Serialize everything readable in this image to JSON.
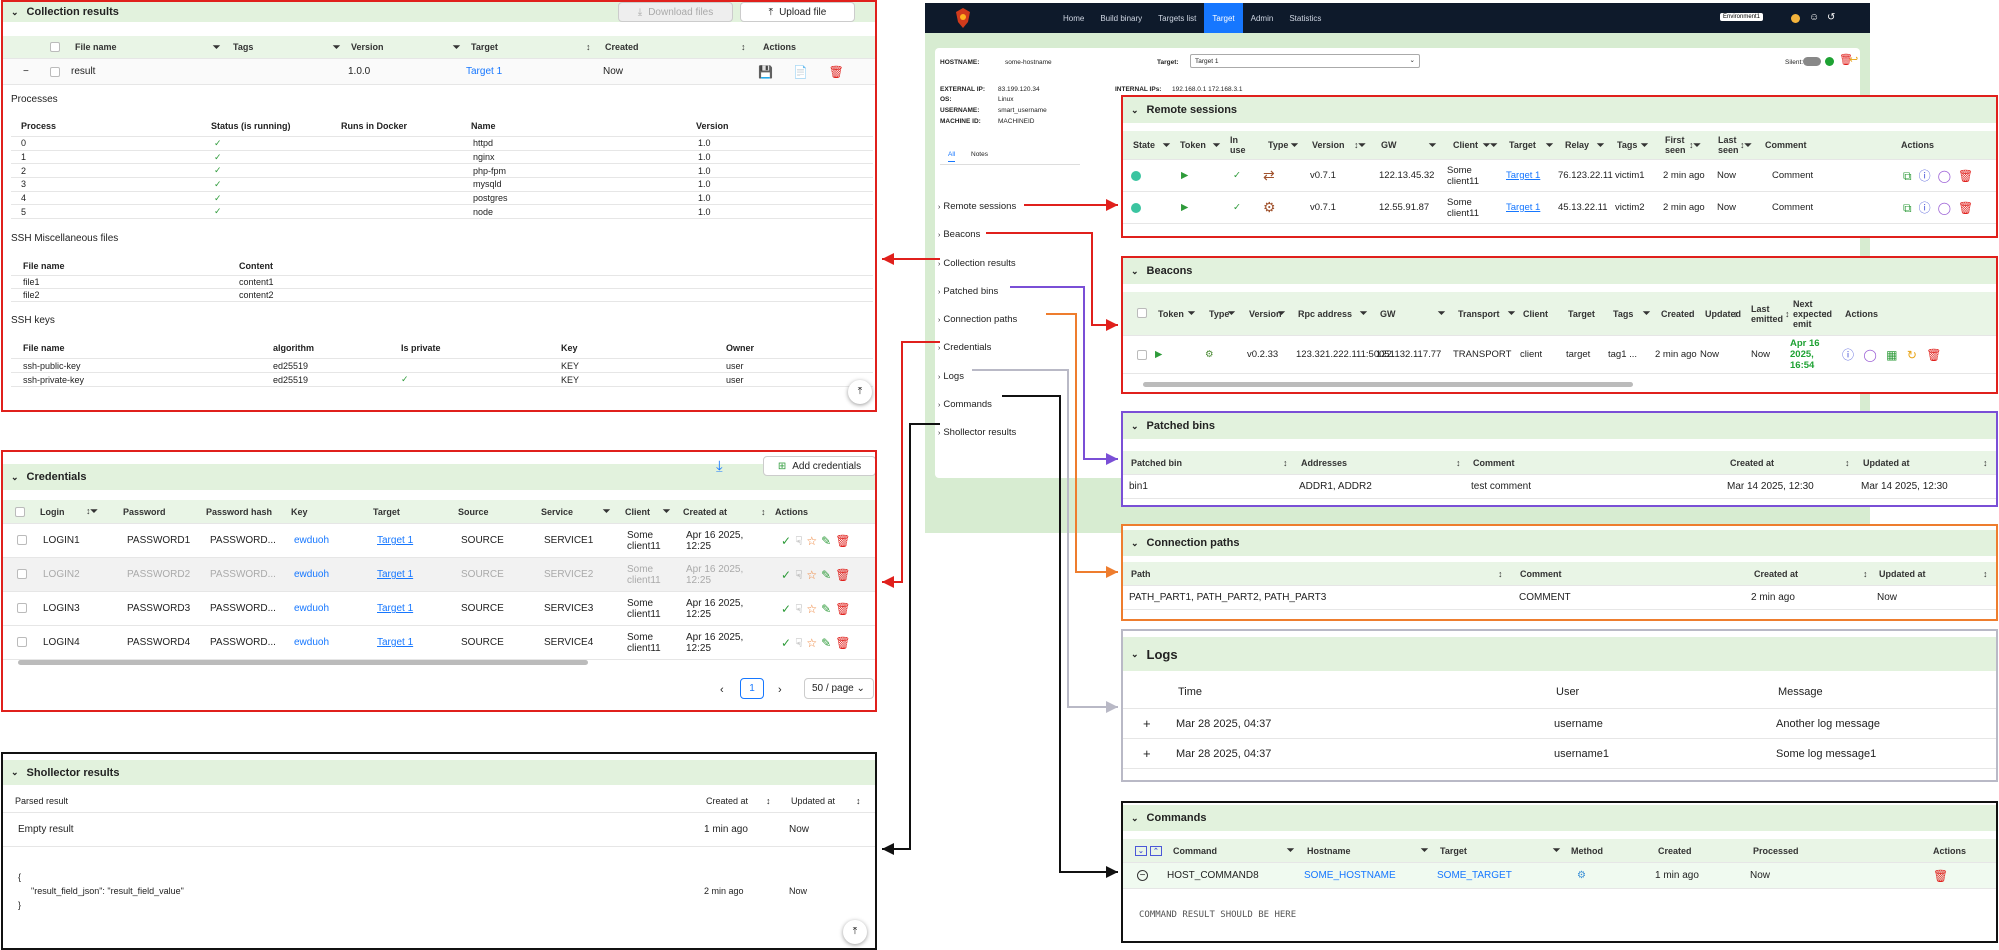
{
  "colors": {
    "red": "#e0201c",
    "black": "#111111",
    "purple": "#7a4fd6",
    "orange": "#ee7d2e",
    "gray": "#b9b9c6",
    "headerGreen": "#e2f2dd",
    "link": "#1677ff",
    "navBg": "#0e1a2b"
  },
  "app": {
    "nav": [
      "Home",
      "Build binary",
      "Targets list",
      "Target",
      "Admin",
      "Statistics"
    ],
    "env_label": "Environment1",
    "hostname_label": "HOSTNAME:",
    "hostname_value": "some-hostname",
    "target_label": "Target:",
    "target_value": "Target 1",
    "silent_label": "Silent:",
    "external_ip_label": "EXTERNAL IP:",
    "external_ip_value": "83.199.120.34",
    "internal_ips_label": "INTERNAL IPs:",
    "internal_ips_value": "192.168.0.1 172.168.3.1",
    "os_label": "OS:",
    "os_value": "Linux",
    "username_label": "USERNAME:",
    "username_value": "smart_username",
    "machine_id_label": "MACHINE ID:",
    "machine_id_value": "MACHINEID",
    "tabs": [
      "All",
      "Notes"
    ],
    "sections": [
      "Remote sessions",
      "Beacons",
      "Collection results",
      "Patched bins",
      "Connection paths",
      "Credentials",
      "Logs",
      "Commands",
      "Shollector results"
    ]
  },
  "collection": {
    "title": "Collection results",
    "download_label": "Download files",
    "upload_label": "Upload file",
    "headers": [
      "File name",
      "Tags",
      "Version",
      "Target",
      "Created",
      "Actions"
    ],
    "row": {
      "name": "result",
      "version": "1.0.0",
      "target": "Target 1",
      "created": "Now"
    },
    "processes_title": "Processes",
    "process_headers": [
      "Process",
      "Status (is running)",
      "Runs in Docker",
      "Name",
      "Version"
    ],
    "processes": [
      [
        "0",
        "httpd",
        "1.0"
      ],
      [
        "1",
        "nginx",
        "1.0"
      ],
      [
        "2",
        "php-fpm",
        "1.0"
      ],
      [
        "3",
        "mysqld",
        "1.0"
      ],
      [
        "4",
        "postgres",
        "1.0"
      ],
      [
        "5",
        "node",
        "1.0"
      ]
    ],
    "ssh_misc_title": "SSH Miscellaneous files",
    "ssh_misc_headers": [
      "File name",
      "Content"
    ],
    "ssh_misc": [
      [
        "file1",
        "content1"
      ],
      [
        "file2",
        "content2"
      ]
    ],
    "ssh_keys_title": "SSH keys",
    "ssh_keys_headers": [
      "File name",
      "algorithm",
      "Is private",
      "Key",
      "Owner"
    ],
    "ssh_keys": [
      [
        "ssh-public-key",
        "ed25519",
        "KEY",
        "user"
      ],
      [
        "ssh-private-key",
        "ed25519",
        "KEY",
        "user"
      ]
    ]
  },
  "credentials": {
    "title": "Credentials",
    "add_label": "Add credentials",
    "headers": [
      "Login",
      "Password",
      "Password hash",
      "Key",
      "Target",
      "Source",
      "Service",
      "Client",
      "Created at",
      "Actions"
    ],
    "rows": [
      [
        "LOGIN1",
        "PASSWORD1",
        "PASSWORD...",
        "ewduoh",
        "Target 1",
        "SOURCE",
        "SERVICE1",
        "Some client11",
        "Apr 16 2025, 12:25"
      ],
      [
        "LOGIN2",
        "PASSWORD2",
        "PASSWORD...",
        "ewduoh",
        "Target 1",
        "SOURCE",
        "SERVICE2",
        "Some client11",
        "Apr 16 2025, 12:25"
      ],
      [
        "LOGIN3",
        "PASSWORD3",
        "PASSWORD...",
        "ewduoh",
        "Target 1",
        "SOURCE",
        "SERVICE3",
        "Some client11",
        "Apr 16 2025, 12:25"
      ],
      [
        "LOGIN4",
        "PASSWORD4",
        "PASSWORD...",
        "ewduoh",
        "Target 1",
        "SOURCE",
        "SERVICE4",
        "Some client11",
        "Apr 16 2025, 12:25"
      ]
    ],
    "page": "1",
    "page_size": "50 / page"
  },
  "shollector": {
    "title": "Shollector results",
    "headers": [
      "Parsed result",
      "Created at",
      "Updated at"
    ],
    "rows": [
      [
        "Empty result",
        "1 min ago",
        "Now"
      ]
    ],
    "json_lines": [
      "{",
      "\"result_field_json\": \"result_field_value\"",
      "}"
    ],
    "json_created": "2 min ago",
    "json_updated": "Now"
  },
  "remote": {
    "title": "Remote sessions",
    "headers": [
      "State",
      "Token",
      "In use",
      "Type",
      "Version",
      "GW",
      "Client",
      "Target",
      "Relay",
      "Tags",
      "First seen",
      "Last seen",
      "Comment",
      "Actions"
    ],
    "rows": [
      [
        "v0.7.1",
        "122.13.45.32",
        "Some client11",
        "Target 1",
        "76.123.22.11",
        "victim1",
        "2 min ago",
        "Now",
        "Comment"
      ],
      [
        "v0.7.1",
        "12.55.91.87",
        "Some client11",
        "Target 1",
        "45.13.22.11",
        "victim2",
        "2 min ago",
        "Now",
        "Comment"
      ]
    ]
  },
  "beacons": {
    "title": "Beacons",
    "headers": [
      "Token",
      "Type",
      "Version",
      "Rpc address",
      "GW",
      "Transport",
      "Client",
      "Target",
      "Tags",
      "Created",
      "Updated",
      "Last emitted",
      "Next expected emit",
      "Actions"
    ],
    "row": [
      "v0.2.33",
      "123.321.222.111:50051",
      "122.132.117.77",
      "TRANSPORT",
      "client",
      "target",
      "tag1 ...",
      "2 min ago",
      "Now",
      "Now",
      "Apr 16 2025, 16:54"
    ]
  },
  "patched": {
    "title": "Patched bins",
    "headers": [
      "Patched bin",
      "Addresses",
      "Comment",
      "Created at",
      "Updated at"
    ],
    "row": [
      "bin1",
      "ADDR1, ADDR2",
      "test comment",
      "Mar 14 2025, 12:30",
      "Mar 14 2025, 12:30"
    ]
  },
  "paths": {
    "title": "Connection paths",
    "headers": [
      "Path",
      "Comment",
      "Created at",
      "Updated at"
    ],
    "row": [
      "PATH_PART1, PATH_PART2, PATH_PART3",
      "COMMENT",
      "2 min ago",
      "Now"
    ]
  },
  "logs": {
    "title": "Logs",
    "headers": [
      "Time",
      "User",
      "Message"
    ],
    "rows": [
      [
        "Mar 28 2025, 04:37",
        "username",
        "Another log message"
      ],
      [
        "Mar 28 2025, 04:37",
        "username1",
        "Some log message1"
      ]
    ]
  },
  "commands": {
    "title": "Commands",
    "headers": [
      "Command",
      "Hostname",
      "Target",
      "Method",
      "Created",
      "Processed",
      "Actions"
    ],
    "row": [
      "HOST_COMMAND8",
      "SOME_HOSTNAME",
      "SOME_TARGET",
      "1 min ago",
      "Now"
    ],
    "result": "COMMAND RESULT SHOULD BE HERE"
  }
}
